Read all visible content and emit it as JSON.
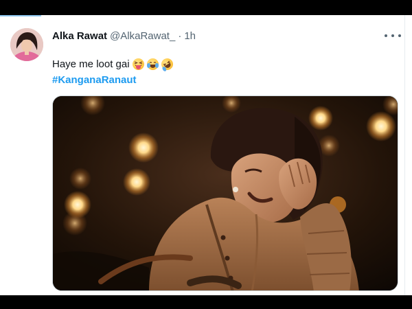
{
  "tweet": {
    "author_name": "Alka Rawat",
    "author_handle": "@AlkaRawat_",
    "separator": "·",
    "time": "1h",
    "text": "Haye me loot gai",
    "text_emojis": [
      "squinting-tongue-emoji",
      "tears-of-joy-emoji",
      "rolling-laughing-emoji"
    ],
    "hashtag": "#KanganaRanaut",
    "more_icon": "more-options-icon"
  },
  "colors": {
    "link_blue": "#1d9bf0",
    "secondary_text": "#536471",
    "primary_text": "#0f1419",
    "letterbox": "#000000"
  }
}
